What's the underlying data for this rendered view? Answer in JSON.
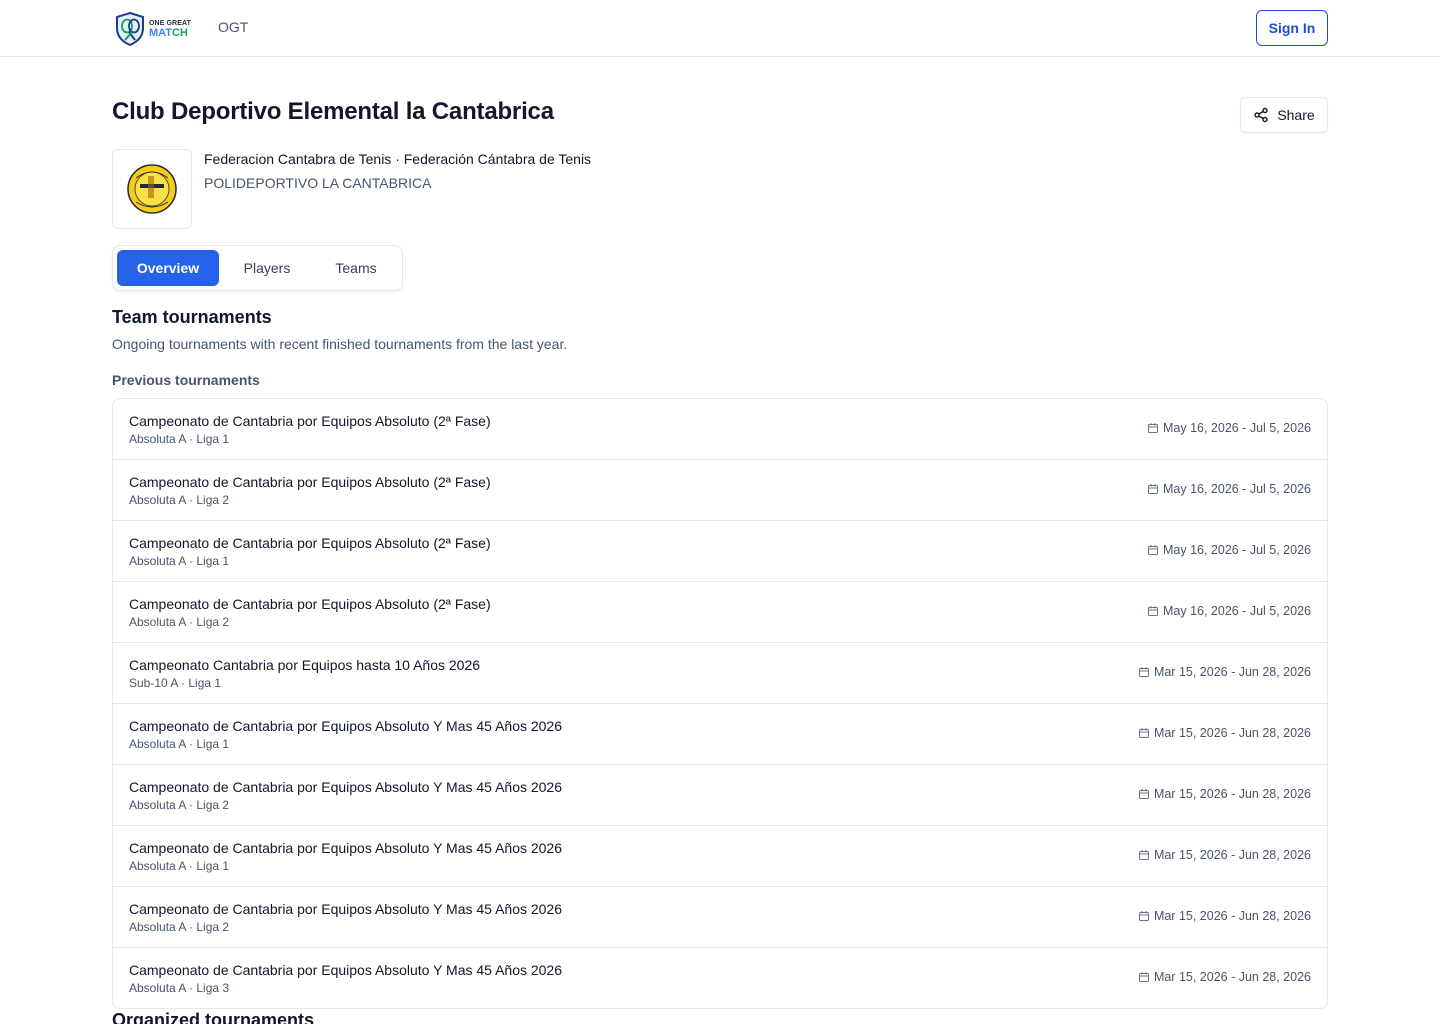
{
  "header": {
    "logo_line1": "ONE GREAT",
    "logo_line2_a": "MAT",
    "logo_line2_b": "CH",
    "brand": "OGT",
    "signin_label": "Sign In"
  },
  "club": {
    "name": "Club Deportivo Elemental la Cantabrica",
    "share_label": "Share",
    "federation": "Federacion Cantabra de Tenis · Federación Cántabra de Tenis",
    "venue": "POLIDEPORTIVO LA CANTABRICA"
  },
  "tabs": [
    {
      "label": "Overview",
      "active": true
    },
    {
      "label": "Players",
      "active": false
    },
    {
      "label": "Teams",
      "active": false
    }
  ],
  "team_section": {
    "title": "Team tournaments",
    "subtitle": "Ongoing tournaments with recent finished tournaments from the last year.",
    "previous_label": "Previous tournaments"
  },
  "tournaments": [
    {
      "title": "Campeonato de Cantabria por Equipos Absoluto (2ª Fase)",
      "sub": "Absoluta A · Liga 1",
      "dates": "May 16, 2026 - Jul 5, 2026"
    },
    {
      "title": "Campeonato de Cantabria por Equipos Absoluto (2ª Fase)",
      "sub": "Absoluta A · Liga 2",
      "dates": "May 16, 2026 - Jul 5, 2026"
    },
    {
      "title": "Campeonato de Cantabria por Equipos Absoluto (2ª Fase)",
      "sub": "Absoluta A · Liga 1",
      "dates": "May 16, 2026 - Jul 5, 2026"
    },
    {
      "title": "Campeonato de Cantabria por Equipos Absoluto (2ª Fase)",
      "sub": "Absoluta A · Liga 2",
      "dates": "May 16, 2026 - Jul 5, 2026"
    },
    {
      "title": "Campeonato Cantabria por Equipos hasta 10 Años 2026",
      "sub": "Sub-10 A · Liga 1",
      "dates": "Mar 15, 2026 - Jun 28, 2026"
    },
    {
      "title": "Campeonato de Cantabria por Equipos Absoluto Y Mas 45 Años 2026",
      "sub": "Absoluta A · Liga 1",
      "dates": "Mar 15, 2026 - Jun 28, 2026"
    },
    {
      "title": "Campeonato de Cantabria por Equipos Absoluto Y Mas 45 Años 2026",
      "sub": "Absoluta A · Liga 2",
      "dates": "Mar 15, 2026 - Jun 28, 2026"
    },
    {
      "title": "Campeonato de Cantabria por Equipos Absoluto Y Mas 45 Años 2026",
      "sub": "Absoluta A · Liga 1",
      "dates": "Mar 15, 2026 - Jun 28, 2026"
    },
    {
      "title": "Campeonato de Cantabria por Equipos Absoluto Y Mas 45 Años 2026",
      "sub": "Absoluta A · Liga 2",
      "dates": "Mar 15, 2026 - Jun 28, 2026"
    },
    {
      "title": "Campeonato de Cantabria por Equipos Absoluto Y Mas 45 Años 2026",
      "sub": "Absoluta A · Liga 3",
      "dates": "Mar 15, 2026 - Jun 28, 2026"
    }
  ],
  "organized_section": {
    "title": "Organized tournaments"
  },
  "icons": {
    "logo": "shield-racket-icon",
    "share": "share-icon",
    "date": "calendar-icon",
    "club_logo": "club-crest"
  },
  "colors": {
    "accent": "#2563eb",
    "signin": "#1d4ed8",
    "border": "#e5e7eb",
    "muted_text": "#475569"
  }
}
